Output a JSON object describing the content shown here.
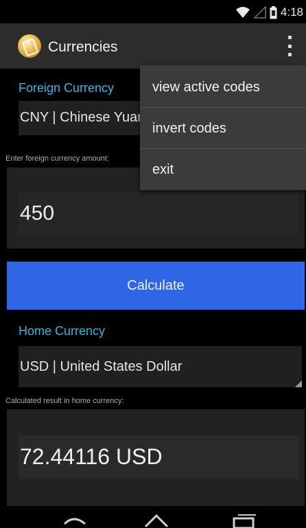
{
  "status_bar": {
    "time": "4:18"
  },
  "action_bar": {
    "title": "Currencies"
  },
  "foreign": {
    "label": "Foreign Currency",
    "spinner_value": "CNY | Chinese Yuan",
    "amount_hint": "Enter foreign currency amount:",
    "amount_value": "450"
  },
  "calculate_label": "Calculate",
  "home": {
    "label": "Home Currency",
    "spinner_value": "USD | United States Dollar",
    "result_hint": "Calculated result in home currency:",
    "result_value": "72.44116 USD"
  },
  "menu": {
    "items": [
      {
        "label": "view active codes"
      },
      {
        "label": "invert codes"
      },
      {
        "label": "exit"
      }
    ]
  },
  "colors": {
    "accent_label": "#33b5e5",
    "button": "#2f66e6",
    "action_bar": "#2c2c2c",
    "menu_bg": "#3b3b3b"
  },
  "icons": [
    "wifi-icon",
    "signal-icon",
    "battery-icon",
    "app-logo-icon",
    "overflow-menu-icon",
    "back-icon",
    "home-icon",
    "recents-icon"
  ]
}
